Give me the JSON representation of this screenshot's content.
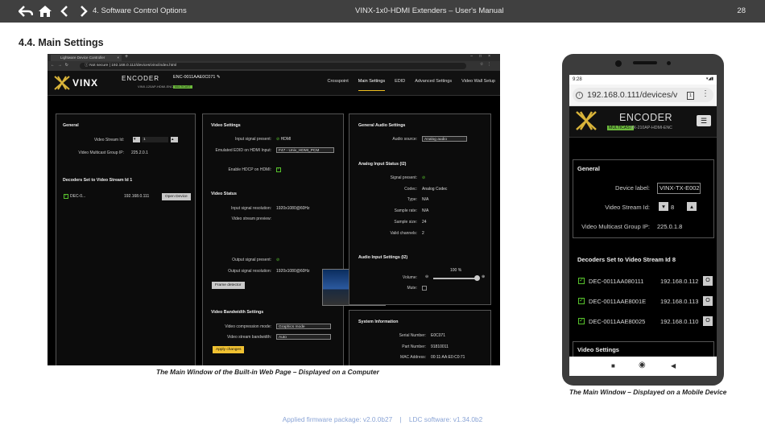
{
  "header": {
    "chapter": "4. Software Control Options",
    "doc_title": "VINX-1x0-HDMI Extenders – User's Manual",
    "page_number": "28",
    "nav_icons": [
      "back-icon",
      "home-icon",
      "prev-icon",
      "next-icon"
    ]
  },
  "section_title": "4.4. Main Settings",
  "browser": {
    "tab_title": "Lightware Device Controller",
    "url_security": "Not secure",
    "url": "192.168.0.112/devices/vinx/index.html",
    "app": {
      "brand": "VINX",
      "mode": "ENCODER",
      "model": "VINX-120AP-HDMI-ENC-ENT",
      "badge": "MULTICAST",
      "device_name": "ENC-0011AAE0C071",
      "nav": [
        "Crosspoint",
        "Main Settings",
        "EDID",
        "Advanced Settings",
        "Video Wall Setup"
      ]
    },
    "general": {
      "title": "General",
      "stream_id_label": "Video Stream Id:",
      "stream_id_value": "1",
      "multicast_label": "Video Multicast Group IP:",
      "multicast_value": "225.2.0.1",
      "decoders_title": "Decoders Set to Video Stream Id 1",
      "decoder_name": "DEC-0...",
      "decoder_ip": "192.168.0.111",
      "open_device": "Open Device"
    },
    "video_settings": {
      "title": "Video Settings",
      "input_present_label": "Input signal present:",
      "input_present_value": "HDMI",
      "edid_label": "Emulated EDID on HDMI Input:",
      "edid_value": "F47 - Univ_HDMI_PCM",
      "hdcp_label": "Enable HDCP on HDMI:"
    },
    "video_status": {
      "title": "Video Status",
      "input_res_label": "Input signal resolution:",
      "input_res_value": "1920x1080@60Hz",
      "preview_label": "Video stream preview:",
      "output_present_label": "Output signal present:",
      "output_res_label": "Output signal resolution:",
      "output_res_value": "1920x1080@60Hz",
      "frame_detector": "Frame detector"
    },
    "bandwidth": {
      "title": "Video Bandwidth Settings",
      "mode_label": "Video compression mode:",
      "mode_value": "Graphics mode",
      "bw_label": "Video stream bandwidth:",
      "bw_value": "Auto",
      "apply": "Apply changes"
    },
    "audio": {
      "title": "General Audio Settings",
      "source_label": "Audio source:",
      "source_value": "Analog audio",
      "analog_title": "Analog Input Status (I2)",
      "signal_label": "Signal present:",
      "codec_label": "Codec:",
      "codec_value": "Analog Codec",
      "type_label": "Type:",
      "type_value": "N/A",
      "rate_label": "Sample rate:",
      "rate_value": "N/A",
      "size_label": "Sample size:",
      "size_value": "24",
      "channels_label": "Valid channels:",
      "channels_value": "2",
      "input_settings_title": "Audio Input Settings (I2)",
      "volume_label": "Volume:",
      "volume_value": "100 %",
      "volume_level": 1.0,
      "mute_label": "Mute:"
    },
    "system": {
      "title": "System Information",
      "serial_label": "Serial Number:",
      "serial_value": "E0C071",
      "part_label": "Part Number:",
      "part_value": "91810011",
      "mac_label": "MAC Address:",
      "mac_value": "00:11:AA:E0:C0:71"
    }
  },
  "caption_computer": "The Main Window of the Built-in Web Page – Displayed on a Computer",
  "phone": {
    "time": "9:28",
    "url": "192.168.0.111/devices/v",
    "tabs_count": "1",
    "mode": "ENCODER",
    "badge": "MULTICAST",
    "model": "VX-210AP-HDMI-ENC",
    "general_title": "General",
    "device_label_label": "Device label:",
    "device_label_value": "VINX-TX-E002(",
    "stream_id_label": "Video Stream Id:",
    "stream_id_value": "8",
    "multicast_label": "Video Multicast Group IP:",
    "multicast_value": "225.0.1.8",
    "decoders_title": "Decoders Set to Video Stream Id 8",
    "decoders": [
      {
        "name": "DEC-0011AA080111",
        "ip": "192.168.0.112",
        "btn": "O"
      },
      {
        "name": "DEC-0011AAE8001E",
        "ip": "192.168.0.113",
        "btn": "O"
      },
      {
        "name": "DEC-0011AAE80025",
        "ip": "192.168.0.110",
        "btn": "O"
      }
    ],
    "video_settings_title": "Video Settings"
  },
  "caption_mobile": "The Main Window – Displayed on a Mobile Device",
  "footer": {
    "firmware": "Applied firmware package: v2.0.0b27",
    "separator": "|",
    "ldc": "LDC software: v1.34.0b2"
  }
}
